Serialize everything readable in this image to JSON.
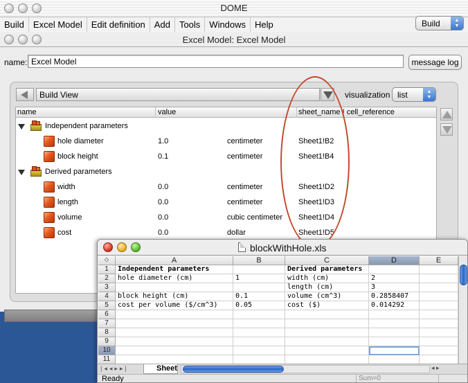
{
  "dome_window": {
    "title": "DOME",
    "menus": [
      "Build",
      "Excel Model",
      "Edit definition",
      "Add",
      "Tools",
      "Windows",
      "Help"
    ],
    "mode_select": "Build"
  },
  "model_window": {
    "title": "Excel Model: Excel Model",
    "name_label": "name:",
    "name_value": "Excel Model",
    "message_log_button": "message log",
    "view_select": "Build View",
    "visualization_label": "visualization",
    "visualization_select": "list",
    "columns": [
      "name",
      "value",
      "sheet_name ! cell_reference"
    ],
    "groups": [
      {
        "name": "Independent parameters",
        "items": [
          {
            "name": "hole diameter",
            "value": "1.0",
            "unit": "centimeter",
            "ref": "Sheet1!B2"
          },
          {
            "name": "block height",
            "value": "0.1",
            "unit": "centimeter",
            "ref": "Sheet1!B4"
          }
        ]
      },
      {
        "name": "Derived parameters",
        "items": [
          {
            "name": "width",
            "value": "0.0",
            "unit": "centimeter",
            "ref": "Sheet1!D2"
          },
          {
            "name": "length",
            "value": "0.0",
            "unit": "centimeter",
            "ref": "Sheet1!D3"
          },
          {
            "name": "volume",
            "value": "0.0",
            "unit": "cubic centimeter",
            "ref": "Sheet1!D4"
          },
          {
            "name": "cost",
            "value": "0.0",
            "unit": "dollar",
            "ref": "Sheet1!D5"
          }
        ]
      }
    ]
  },
  "spreadsheet": {
    "title": "blockWithHole.xls",
    "col_headers": [
      "A",
      "B",
      "C",
      "D",
      "E"
    ],
    "selected_col": "D",
    "row_numbers": [
      "1",
      "2",
      "3",
      "4",
      "5",
      "6",
      "7",
      "8",
      "9",
      "10",
      "11"
    ],
    "selected_row": "10",
    "rows": [
      [
        "Independent parameters",
        "",
        "Derived parameters",
        "",
        ""
      ],
      [
        "hole diameter (cm)",
        "1",
        "width (cm)",
        "2",
        ""
      ],
      [
        "",
        "",
        "length (cm)",
        "3",
        ""
      ],
      [
        "block height (cm)",
        "0.1",
        "volume (cm^3)",
        "0.2858407",
        ""
      ],
      [
        "cost per volume ($/cm^3)",
        "0.05",
        "cost ($)",
        "0.014292",
        ""
      ],
      [
        "",
        "",
        "",
        "",
        ""
      ],
      [
        "",
        "",
        "",
        "",
        ""
      ],
      [
        "",
        "",
        "",
        "",
        ""
      ],
      [
        "",
        "",
        "",
        "",
        ""
      ],
      [
        "",
        "",
        "",
        "",
        ""
      ],
      [
        "",
        "",
        "",
        "",
        ""
      ]
    ],
    "sheet_tab": "Sheet",
    "status": "Ready",
    "sum": "Sum=0"
  }
}
